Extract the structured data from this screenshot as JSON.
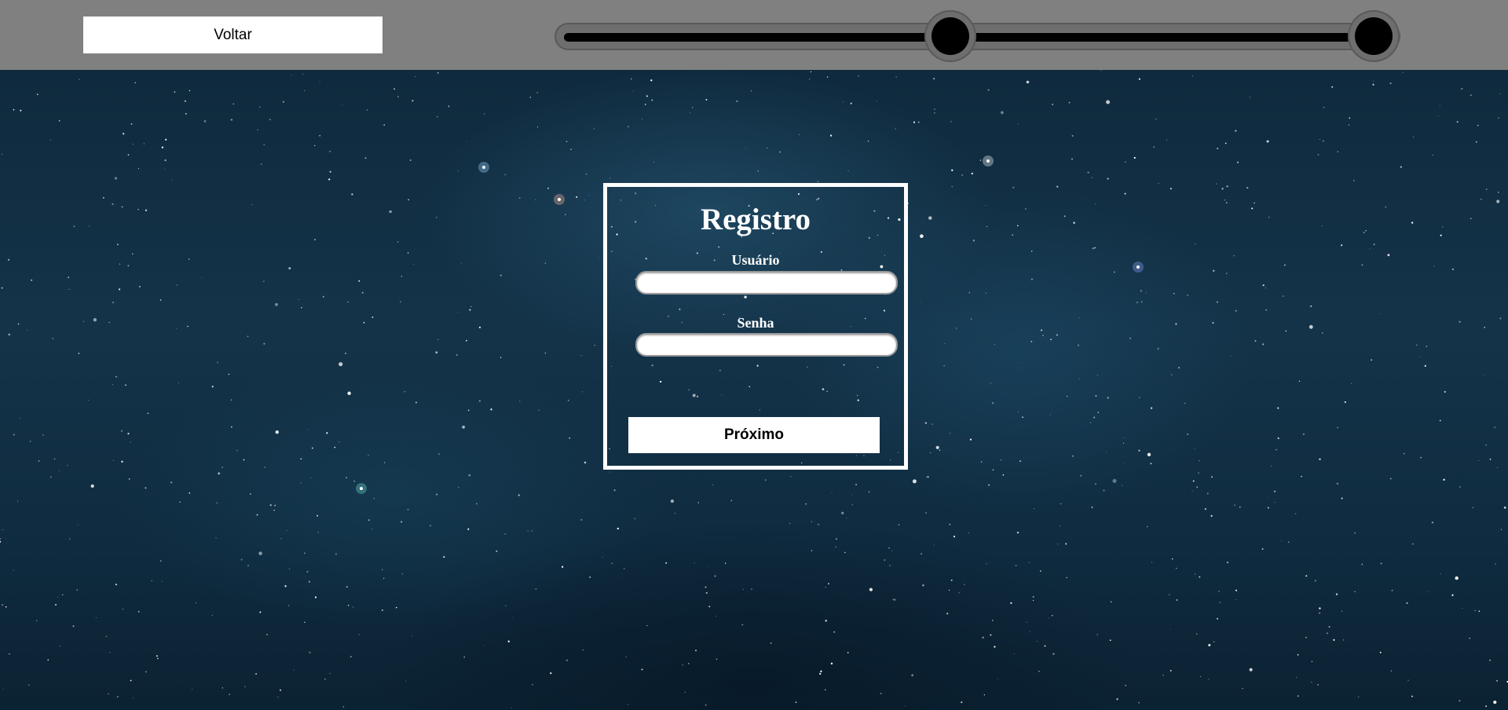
{
  "topbar": {
    "back_label": "Voltar",
    "progress": {
      "total_steps": 3,
      "current_step": 2
    },
    "background_color": "#808080"
  },
  "register": {
    "title": "Registro",
    "username_label": "Usuário",
    "username_value": "",
    "password_label": "Senha",
    "password_value": "",
    "next_label": "Próximo"
  },
  "colors": {
    "space_background": "#0f2a3d",
    "panel_border": "#ffffff",
    "button_background": "#ffffff"
  }
}
